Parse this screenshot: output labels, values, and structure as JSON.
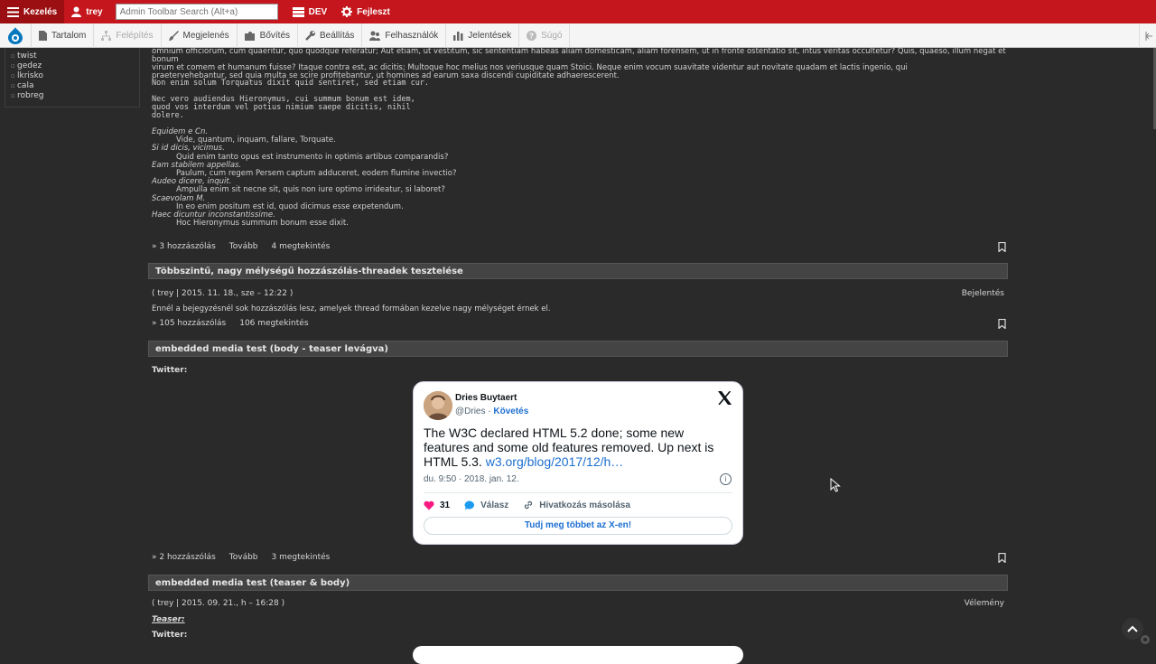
{
  "toolbar": {
    "manage": "Kezelés",
    "user": "trey",
    "search_placeholder": "Admin Toolbar Search (Alt+a)",
    "env": "DEV",
    "dev": "Fejleszt"
  },
  "tray": {
    "items": [
      "Tartalom",
      "Felépítés",
      "Megjelenés",
      "Bővítés",
      "Beállítás",
      "Felhasználók",
      "Jelentések",
      "Súgó"
    ]
  },
  "sidebar": {
    "users": [
      "twist",
      "gedez",
      "lkrisko",
      "cala",
      "robreg"
    ]
  },
  "post1": {
    "para1_l1": "omnium officiorum, cum quaeritur, quo quodque referatur; Aut etiam, ut vestitum, sic sententiam habeas aliam domesticam, aliam forensem, ut in fronte ostentatio sit, intus veritas occultetur? Quis, quaeso, illum negat et bonum",
    "para1_l2": "virum et comem et humanum fuisse? Itaque contra est, ac dicitis; Multoque hoc melius nos veriusque quam Stoici. Neque enim vocum suavitate videntur aut novitate quadam et lactis ingenio, qui",
    "para1_l3": "praetervehebantur, sed quia multa se scire profitebantur, ut homines ad earum saxa discendi cupiditate adhaerescerent.",
    "mono1": "Non enim solum Torquatus dixit quid sentiret, sed etiam cur.",
    "mono2": "Nec vero audiendus Hieronymus, cui summum bonum est idem,\nquod vos interdum vel potius nimium saepe dicitis, nihil\ndolere.",
    "dl": [
      {
        "dt": "Equidem e Cn.",
        "dd": "Vide, quantum, inquam, fallare, Torquate."
      },
      {
        "dt": "Si id dicis, vicimus.",
        "dd": "Quid enim tanto opus est instrumento in optimis artibus comparandis?"
      },
      {
        "dt": "Eam stabilem appellas.",
        "dd": "Paulum, cum regem Persem captum adduceret, eodem flumine invectio?"
      },
      {
        "dt": "Audeo dicere, inquit.",
        "dd": "Ampulla enim sit necne sit, quis non iure optimo irrideatur, si laboret?"
      },
      {
        "dt": "Scaevolam M.",
        "dd": "In eo enim positum est id, quod dicimus esse expetendum."
      },
      {
        "dt": "Haec dicuntur inconstantissime.",
        "dd": "Hoc Hieronymus summum bonum esse dixit."
      }
    ],
    "comments": "3 hozzászólás",
    "more": "Tovább",
    "views": "4 megtekintés"
  },
  "post2": {
    "title": "Többszintű, nagy mélységű hozzászólás-threadek tesztelése",
    "meta": "( trey | 2015. 11. 18., sze – 12:22 )",
    "tag": "Bejelentés",
    "body": "Ennél a bejegyzésnél sok hozzászólás lesz, amelyek thread formában kezelve nagy mélységet érnek el.",
    "comments": "105 hozzászólás",
    "views": "106 megtekintés"
  },
  "post3": {
    "title": "embedded media test (body - teaser levágva)",
    "label": "Twitter:",
    "comments": "2 hozzászólás",
    "more": "Tovább",
    "views": "3 megtekintés"
  },
  "tweet": {
    "name": "Dries Buytaert",
    "handle": "@Dries",
    "follow": "Követés",
    "text": "The W3C declared HTML 5.2 done; some new features and some old features removed. Up next is HTML 5.3.",
    "link": "w3.org/blog/2017/12/h…",
    "date": "du. 9:50 · 2018. jan. 12.",
    "likes": "31",
    "reply": "Válasz",
    "copy": "Hivatkozás másolása",
    "more": "Tudj meg többet az X-en!"
  },
  "post4": {
    "title": "embedded media test (teaser & body)",
    "meta": "( trey | 2015. 09. 21., h – 16:28 )",
    "tag": "Vélemény",
    "teaser": "Teaser:",
    "label": "Twitter:"
  },
  "colors": {
    "toolbar": "#c4161c",
    "background": "#2a2a2a",
    "link": "#1d6fd0"
  }
}
